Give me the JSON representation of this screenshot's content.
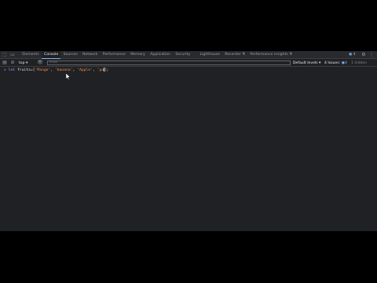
{
  "devtools": {
    "tabs": [
      {
        "label": "Elements",
        "active": false
      },
      {
        "label": "Console",
        "active": true
      },
      {
        "label": "Sources",
        "active": false
      },
      {
        "label": "Network",
        "active": false
      },
      {
        "label": "Performance",
        "active": false
      },
      {
        "label": "Memory",
        "active": false
      },
      {
        "label": "Application",
        "active": false
      },
      {
        "label": "Security",
        "active": false
      },
      {
        "label": "Lighthouse",
        "active": false
      },
      {
        "label": "Recorder",
        "active": false
      },
      {
        "label": "Performance insights",
        "active": false
      }
    ],
    "issues_badge": "4",
    "toolbar": {
      "context": "top",
      "filter_placeholder": "Filter",
      "levels": "Default levels",
      "issues_label": "4 Issues:",
      "issues_count": "4",
      "hidden": "1 hidden"
    },
    "console": {
      "prompt": ">",
      "code": {
        "keyword": "let",
        "name": "fruits",
        "open": "=[",
        "items": [
          "'Mango'",
          "'banana'",
          "'Apple'",
          "'pa"
        ],
        "close": "];"
      }
    },
    "colors": {
      "panel_bg": "#202124",
      "accent": "#8ab4f8",
      "string": "#f28b54",
      "keyword": "#c58af9"
    }
  }
}
